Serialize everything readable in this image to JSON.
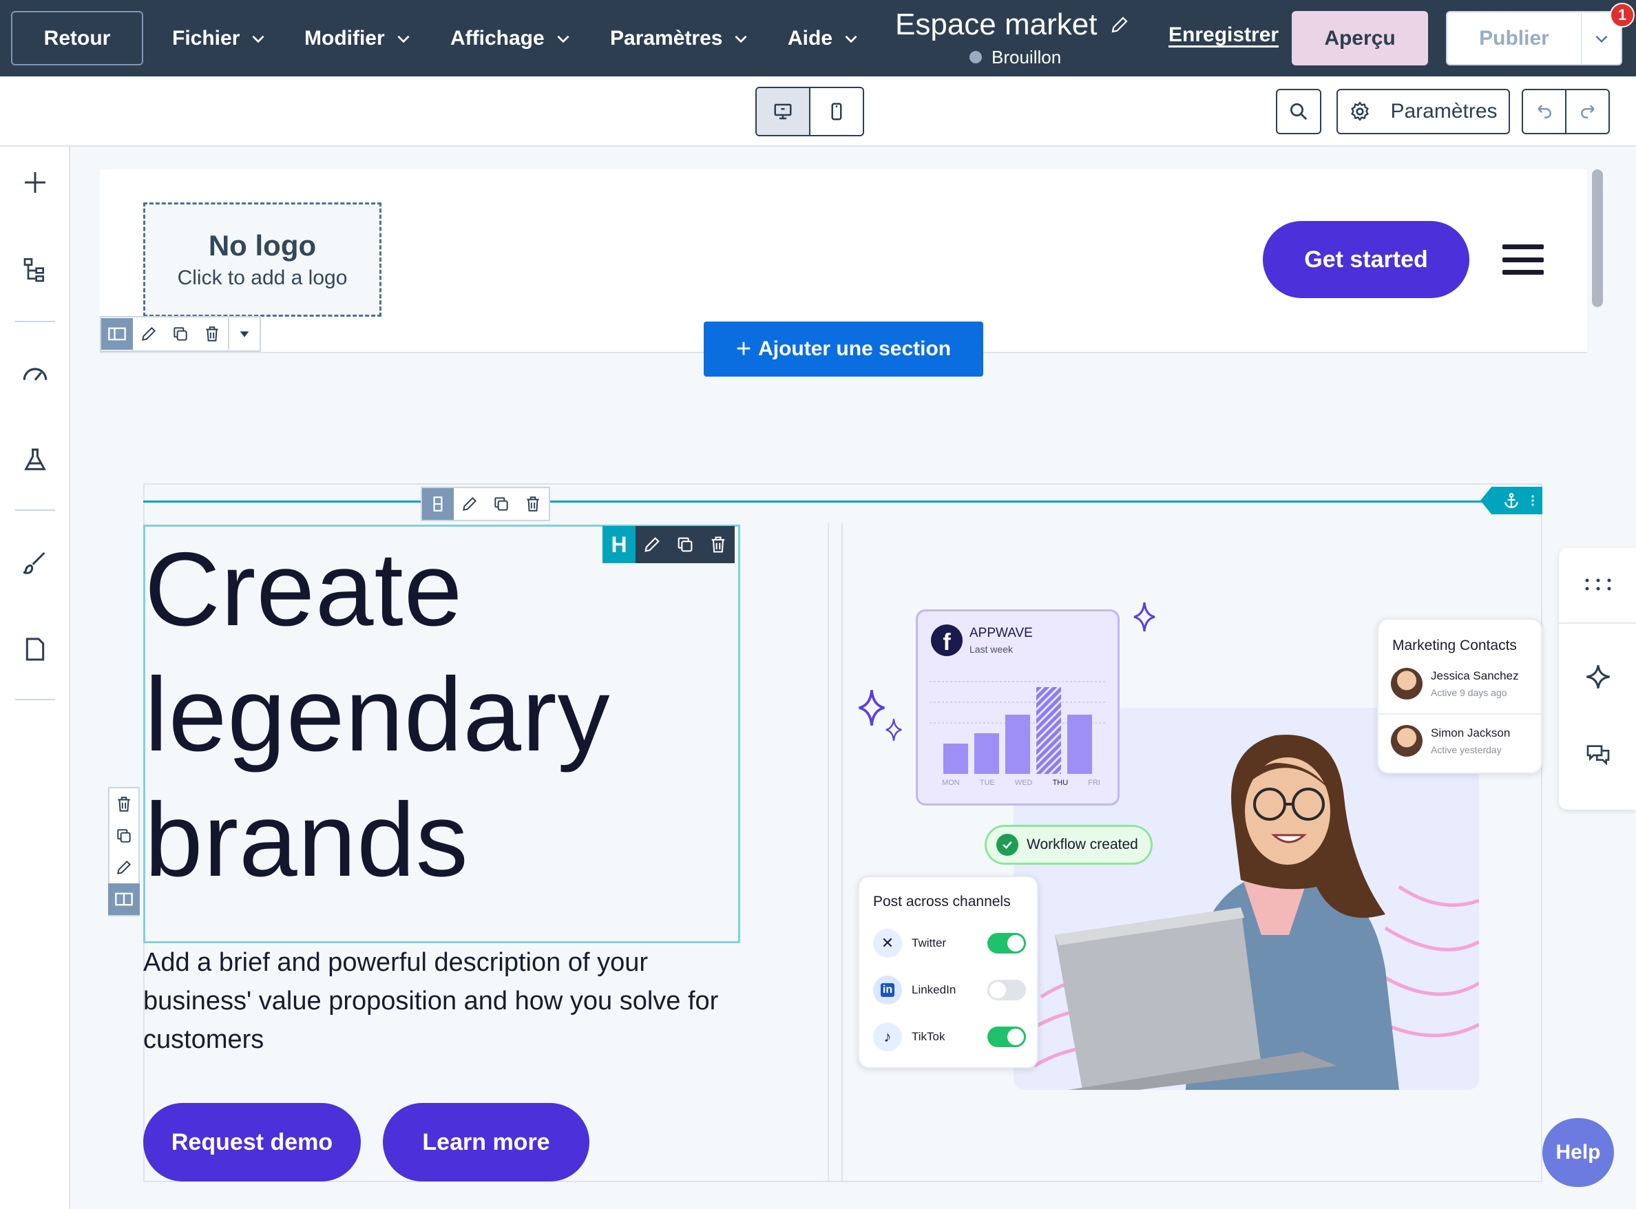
{
  "topbar": {
    "back_label": "Retour",
    "menus": [
      "Fichier",
      "Modifier",
      "Affichage",
      "Paramètres",
      "Aide"
    ],
    "doc_title": "Espace market",
    "doc_status": "Brouillon",
    "save_label": "Enregistrer",
    "preview_label": "Aperçu",
    "publish_label": "Publier",
    "notification_count": "1",
    "accent_preview": "#ead4e6",
    "bar_color": "#2d3e50"
  },
  "subbar": {
    "device_modes": [
      "desktop-icon",
      "mobile-icon"
    ],
    "active_device": "desktop",
    "settings_label": "Paramètres"
  },
  "leftbar": {
    "icons": [
      "plus-icon",
      "layers-tree-icon",
      "gauge-icon",
      "flask-icon",
      "brush-icon",
      "page-icon"
    ]
  },
  "header_section": {
    "logo_title": "No logo",
    "logo_hint": "Click to add a logo",
    "cta_label": "Get started",
    "add_section_label": "Ajouter une section"
  },
  "hero": {
    "heading_lines": [
      "Create",
      "legendary",
      "brands"
    ],
    "heading_tool_letter": "H",
    "description": "Add a brief and powerful description of your business' value proposition and how you solve for customers",
    "primary_cta": "Request demo",
    "secondary_cta": "Learn more",
    "brand_color": "#4c30d9"
  },
  "illustration": {
    "fb_card": {
      "brand": "APPWAVE",
      "period": "Last week",
      "days": [
        "MON",
        "TUE",
        "WED",
        "THU",
        "FRI"
      ],
      "highlight_day": "THU"
    },
    "marketing_contacts": {
      "title": "Marketing Contacts",
      "people": [
        {
          "name": "Jessica Sanchez",
          "sub": "Active 9 days ago"
        },
        {
          "name": "Simon Jackson",
          "sub": "Active yesterday"
        }
      ]
    },
    "workflow_label": "Workflow created",
    "post_card": {
      "title": "Post across channels",
      "channels": [
        {
          "name": "Twitter",
          "on": true
        },
        {
          "name": "LinkedIn",
          "on": false
        },
        {
          "name": "TikTok",
          "on": true
        }
      ]
    }
  },
  "right_panel": {
    "icons": [
      "more-dots-icon",
      "sparkle-icon",
      "comments-icon"
    ]
  },
  "help_label": "Help"
}
